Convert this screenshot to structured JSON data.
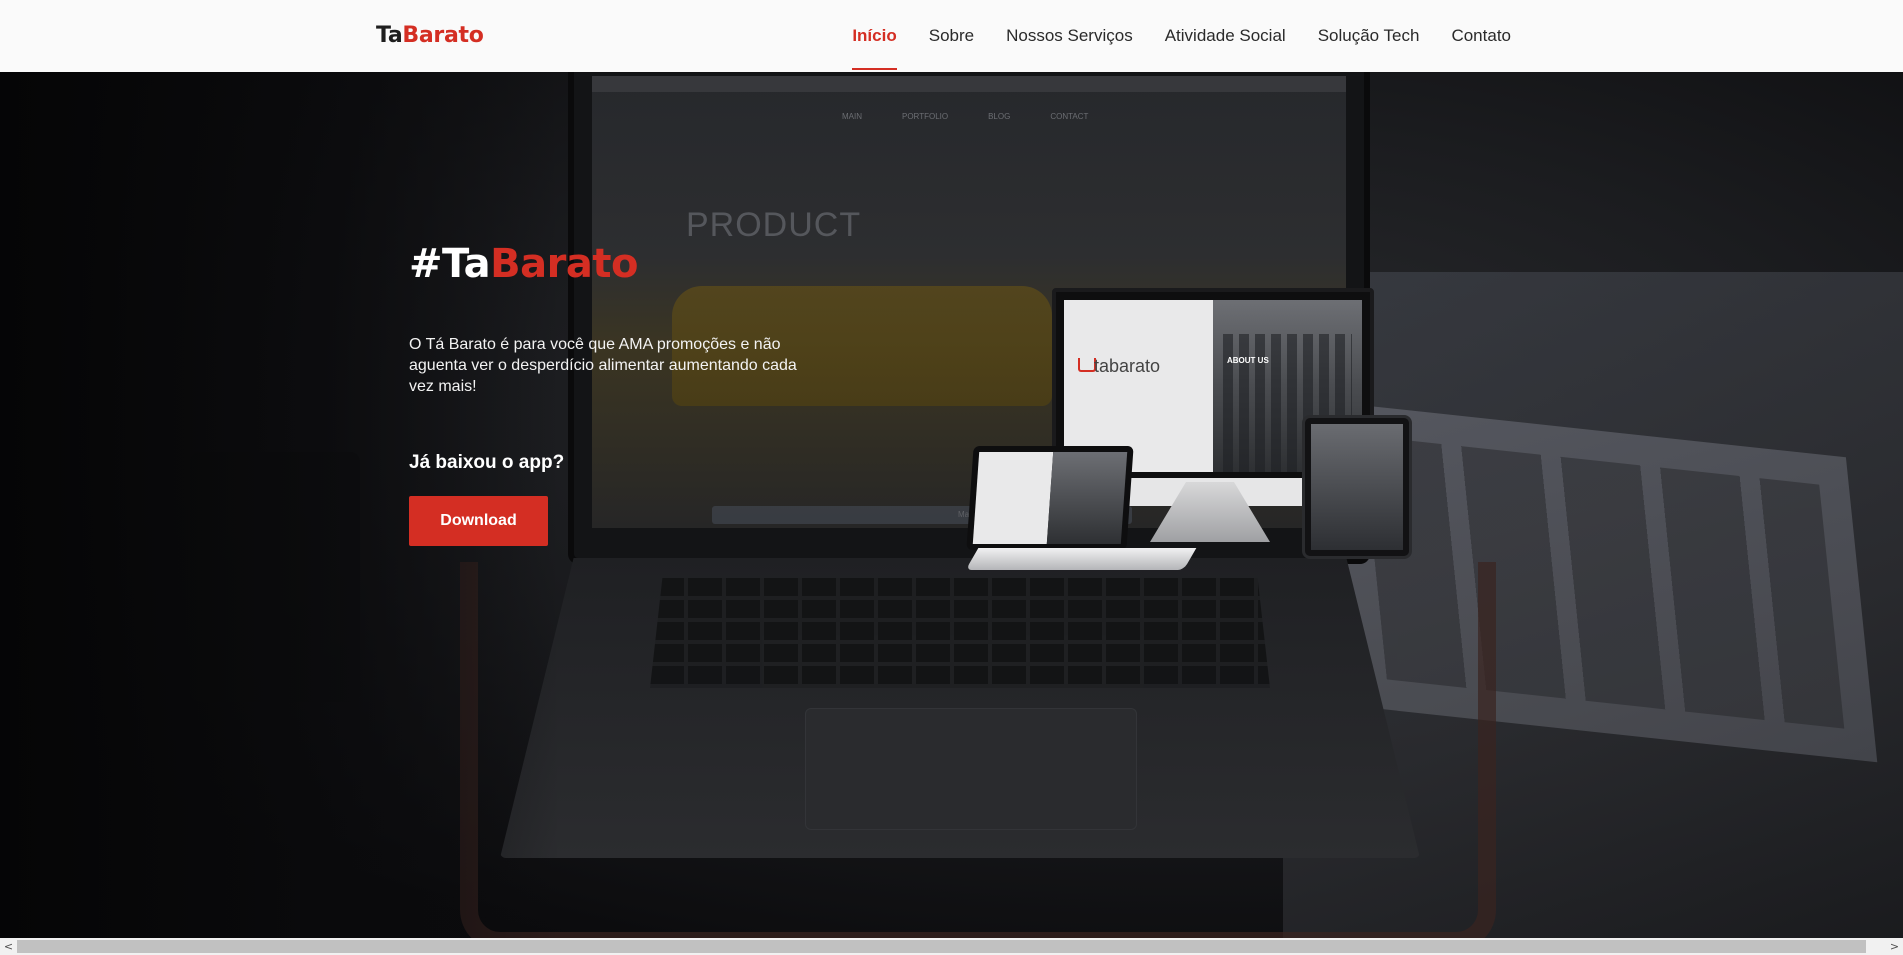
{
  "header": {
    "logo_part1": "Ta",
    "logo_part2": "Barato",
    "nav": [
      {
        "label": "Início",
        "active": true
      },
      {
        "label": "Sobre"
      },
      {
        "label": "Nossos Serviços"
      },
      {
        "label": "Atividade Social"
      },
      {
        "label": "Solução Tech"
      },
      {
        "label": "Contato"
      }
    ]
  },
  "hero": {
    "title_part1": "#Ta",
    "title_part2": "Barato",
    "description": "O Tá Barato é para você que AMA promoções e não aguenta ver o desperdício alimentar aumentando cada vez mais!",
    "question": "Já baixou o app?",
    "button_label": "Download"
  },
  "background_laptop": {
    "menu": [
      "MAIN",
      "PORTFOLIO",
      "BLOG",
      "CONTACT"
    ],
    "product_word": "PRODUCT",
    "brand_label": "MacBook Pro"
  },
  "mockup": {
    "brand": "tabarato",
    "section": "ABOUT US"
  },
  "scrollbar": {
    "left_arrow": "<",
    "right_arrow": ">"
  },
  "colors": {
    "accent": "#d42e23",
    "header_bg": "#fafafa",
    "hero_bg": "#1b1c1f"
  }
}
